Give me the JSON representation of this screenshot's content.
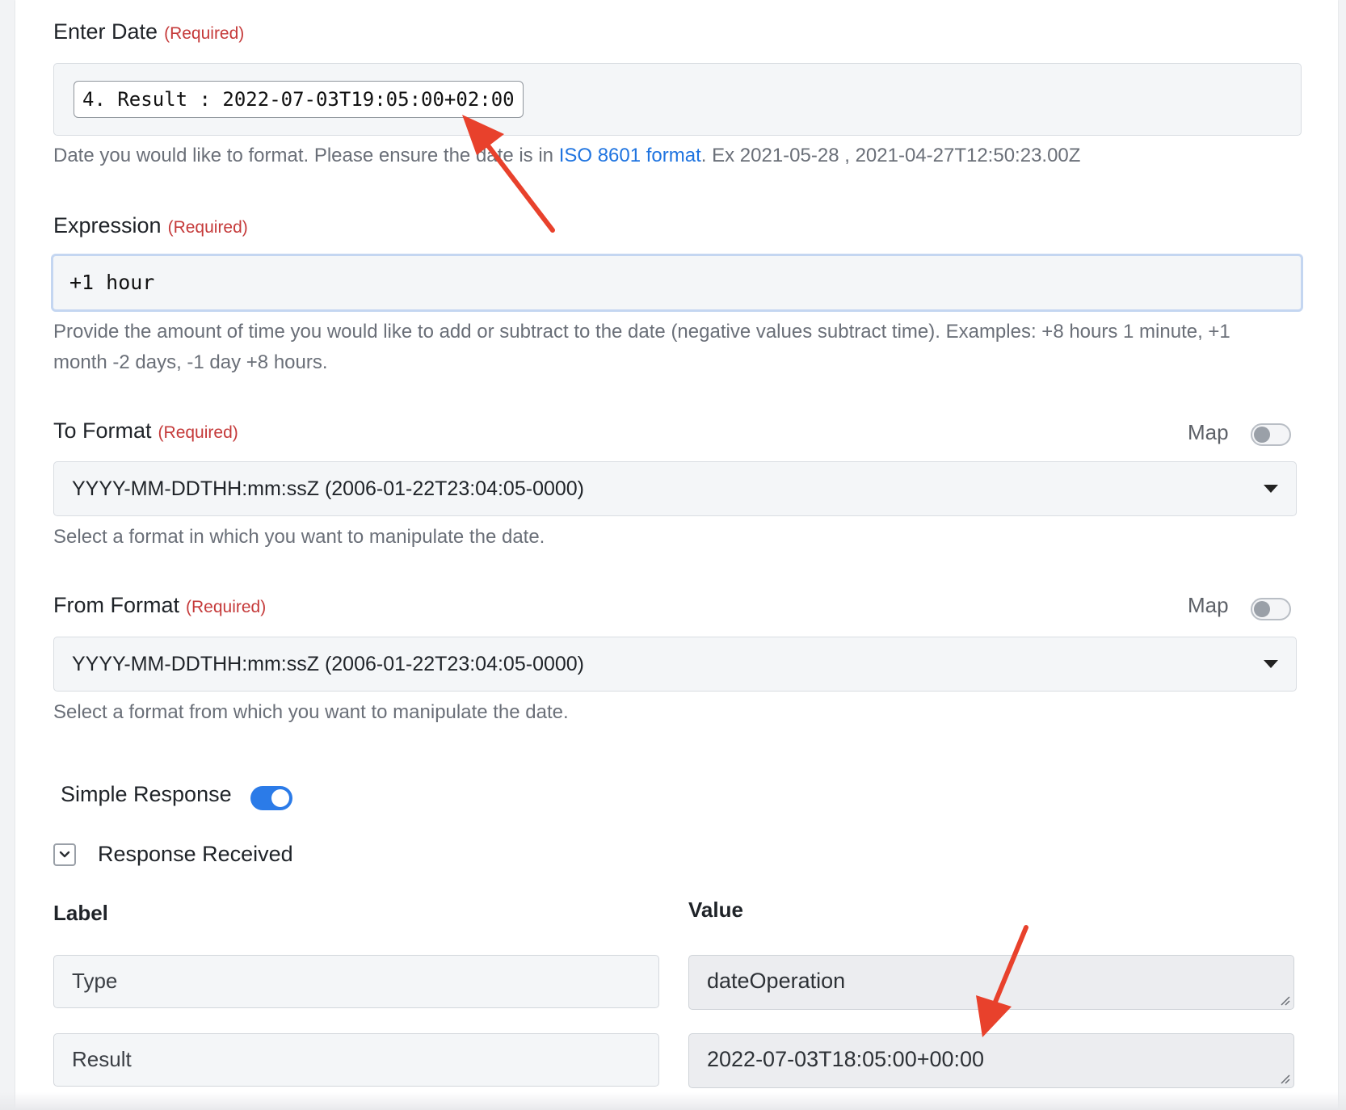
{
  "enter_date": {
    "label": "Enter Date",
    "required": "(Required)",
    "value_pill": "4. Result : 2022-07-03T19:05:00+02:00",
    "help_before_link": "Date you would like to format. Please ensure the date is in ",
    "help_link": "ISO 8601 format",
    "help_after_link": ". Ex 2021-05-28 , 2021-04-27T12:50:23.00Z"
  },
  "expression": {
    "label": "Expression",
    "required": "(Required)",
    "value": "+1 hour",
    "help": "Provide the amount of time you would like to add or subtract to the date (negative values subtract time). Examples: +8 hours 1 minute, +1 month -2 days, -1 day +8 hours."
  },
  "to_format": {
    "label": "To Format",
    "required": "(Required)",
    "map_label": "Map",
    "map_enabled": false,
    "selected": "YYYY-MM-DDTHH:mm:ssZ (2006-01-22T23:04:05-0000)",
    "help": "Select a format in which you want to manipulate the date."
  },
  "from_format": {
    "label": "From Format",
    "required": "(Required)",
    "map_label": "Map",
    "map_enabled": false,
    "selected": "YYYY-MM-DDTHH:mm:ssZ (2006-01-22T23:04:05-0000)",
    "help": "Select a format from which you want to manipulate the date."
  },
  "simple_response": {
    "label": "Simple Response",
    "enabled": true
  },
  "response": {
    "title": "Response Received",
    "expanded": true,
    "label_header": "Label",
    "value_header": "Value",
    "rows": [
      {
        "label": "Type",
        "value": "dateOperation"
      },
      {
        "label": "Result",
        "value": "2022-07-03T18:05:00+00:00"
      }
    ]
  },
  "colors": {
    "required": "#c53a3a",
    "link": "#1f74e0",
    "toggle_on": "#2b7be8",
    "annotation_arrow": "#e8412c"
  }
}
